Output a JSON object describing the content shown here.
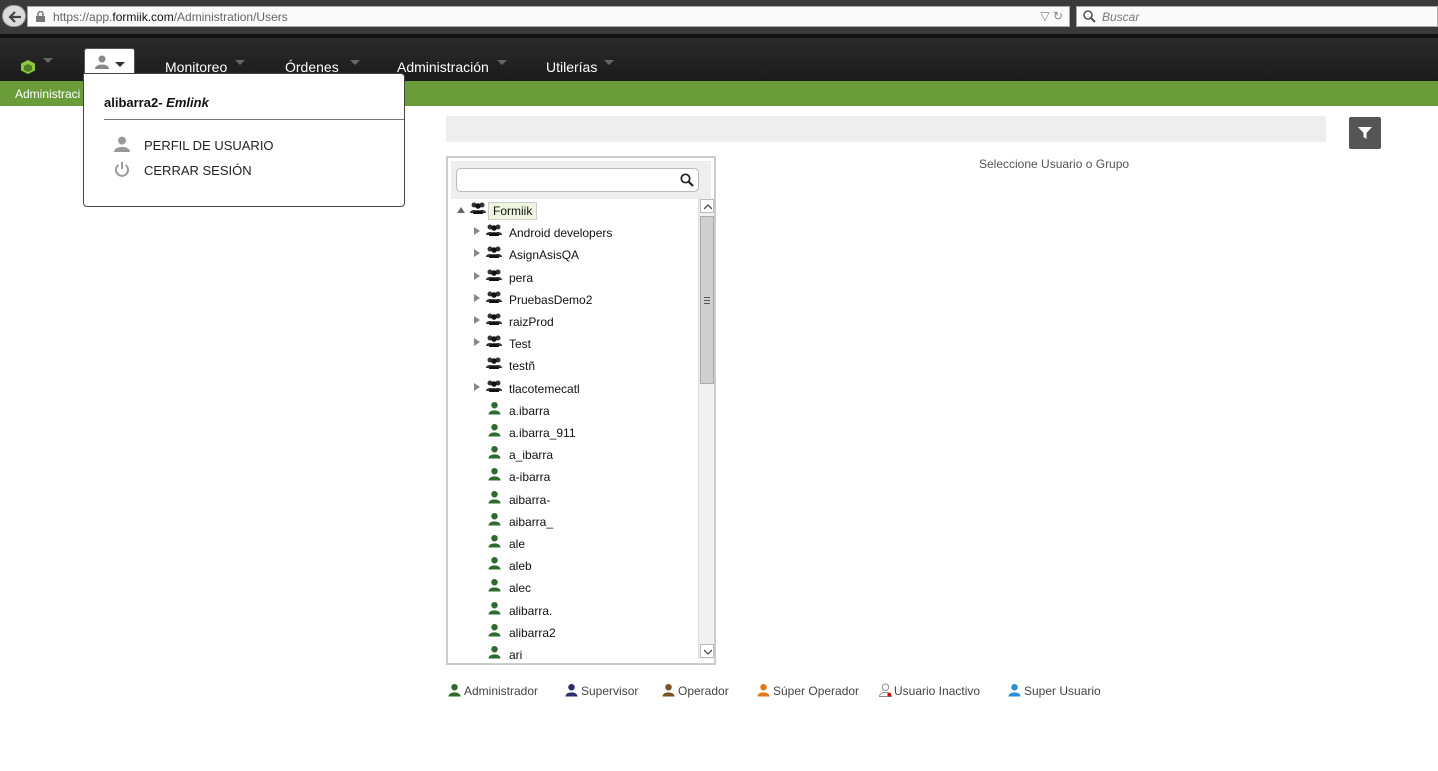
{
  "browser": {
    "url_prefix": "https://app.",
    "url_domain": "formiik.com",
    "url_path": "/Administration/Users",
    "search_placeholder": "Buscar"
  },
  "nav": {
    "items": [
      {
        "label": "Monitoreo"
      },
      {
        "label": "Órdenes"
      },
      {
        "label": "Administración"
      },
      {
        "label": "Utilerías"
      }
    ]
  },
  "breadcrumb": "Administraci",
  "user_menu": {
    "username": "alibarra2-",
    "company": "Emlink",
    "items": [
      {
        "label": "PERFIL DE USUARIO",
        "icon": "user-icon"
      },
      {
        "label": "CERRAR SESIÓN",
        "icon": "power-icon"
      }
    ]
  },
  "hint": "Seleccione Usuario o Grupo",
  "tree": {
    "root": "Formiik",
    "groups": [
      {
        "label": "Android developers",
        "expandable": true
      },
      {
        "label": "AsignAsisQA",
        "expandable": true
      },
      {
        "label": "pera",
        "expandable": true
      },
      {
        "label": "PruebasDemo2",
        "expandable": true
      },
      {
        "label": "raizProd",
        "expandable": true
      },
      {
        "label": "Test",
        "expandable": true
      },
      {
        "label": "testñ",
        "expandable": false
      },
      {
        "label": "tlacotemecatl",
        "expandable": true
      }
    ],
    "users": [
      "a.ibarra",
      "a.ibarra_911",
      "a_ibarra",
      "a-ibarra",
      "aibarra-",
      "aibarra_",
      "ale",
      "aleb",
      "alec",
      "alibarra.",
      "alibarra2",
      "ari"
    ]
  },
  "legend": [
    {
      "label": "Administrador",
      "color": "#2e6b2e"
    },
    {
      "label": "Supervisor",
      "color": "#2b2b6e"
    },
    {
      "label": "Operador",
      "color": "#7a5320"
    },
    {
      "label": "Súper Operador",
      "color": "#e07a18"
    },
    {
      "label": "Usuario Inactivo",
      "color": "#ffffff"
    },
    {
      "label": "Super Usuario",
      "color": "#2a8fd6"
    }
  ],
  "colors": {
    "accent_green": "#6a9c39",
    "navbar": "#1f1f1f"
  }
}
